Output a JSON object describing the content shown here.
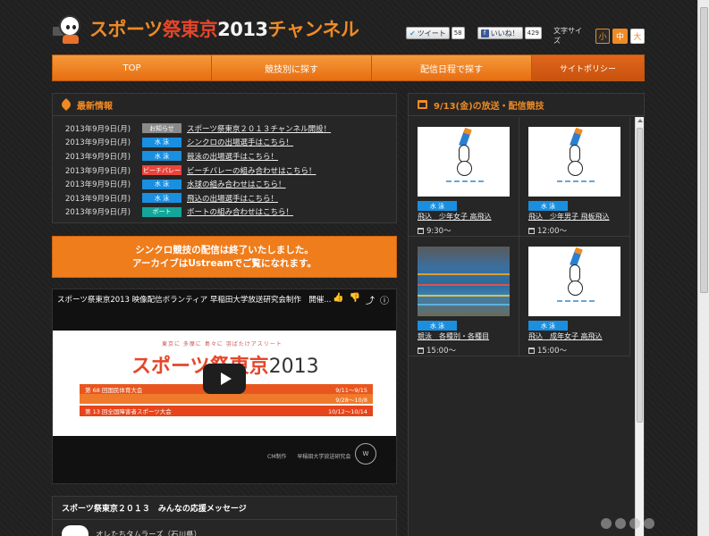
{
  "header": {
    "logo_parts": [
      "スポーツ",
      "祭",
      "東京",
      "2013",
      "チャンネル"
    ],
    "tweet_label": "ツイート",
    "tweet_count": "58",
    "like_label": "いいね！",
    "like_count": "429",
    "fontsize_label": "文字サイズ",
    "fontsize_small": "小",
    "fontsize_mid": "中",
    "fontsize_big": "大"
  },
  "nav": {
    "items": [
      "TOP",
      "競技別に探す",
      "配信日程で探す",
      "サイトポリシー"
    ]
  },
  "news": {
    "title": "最新情報",
    "rows": [
      {
        "date": "2013年9月9日(月)",
        "badge": "お知らせ",
        "badge_color": "#8a8a8a",
        "text": "スポーツ祭東京２０１３チャンネル開設！"
      },
      {
        "date": "2013年9月9日(月)",
        "badge": "水 泳",
        "badge_color": "#1a8fe0",
        "text": "シンクロの出場選手はこちら！"
      },
      {
        "date": "2013年9月9日(月)",
        "badge": "水 泳",
        "badge_color": "#1a8fe0",
        "text": "競泳の出場選手はこちら！"
      },
      {
        "date": "2013年9月9日(月)",
        "badge": "ビーチバレー",
        "badge_color": "#e8453c",
        "text": "ビーチバレーの組み合わせはこちら！"
      },
      {
        "date": "2013年9月9日(月)",
        "badge": "水 泳",
        "badge_color": "#1a8fe0",
        "text": "水球の組み合わせはこちら！"
      },
      {
        "date": "2013年9月9日(月)",
        "badge": "水 泳",
        "badge_color": "#1a8fe0",
        "text": "飛込の出場選手はこちら！"
      },
      {
        "date": "2013年9月9日(月)",
        "badge": "ボート",
        "badge_color": "#14a69a",
        "text": "ボートの組み合わせはこちら！"
      }
    ]
  },
  "notice": {
    "line1": "シンクロ競技の配信は終了いたしました。",
    "line2": "アーカイブはUstreamでご覧になれます。"
  },
  "video": {
    "title": "スポーツ祭東京2013 映像配信ボランティア 早稲田大学放送研究会制作　開催...",
    "slogan": "東京に 多摩に 島々に 羽ばたけアスリート",
    "logo_a": "スポーツ",
    "logo_b": "祭東京",
    "logo_c": "2013",
    "band1_left": "第 68 回国民体育大会",
    "band1_right1": "9/11～9/15",
    "band1_right2": "9/28～10/8",
    "band2_left": "第 13 回全国障害者スポーツ大会",
    "band2_right": "10/12～10/14",
    "credit": "CM制作　　早稲田大学放送研究会"
  },
  "cheer": {
    "title": "スポーツ祭東京２０１３　みんなの応援メッセージ",
    "name": "オレたちタムラーズ（石川県）"
  },
  "schedule": {
    "title": "9/13(金)の放送・配信競技",
    "cards": [
      {
        "badge": "水 泳",
        "title": "飛込　少年女子 高飛込",
        "time": "9:30～",
        "thumb": "diver"
      },
      {
        "badge": "水 泳",
        "title": "飛込　少年男子 飛板飛込",
        "time": "12:00～",
        "thumb": "diver"
      },
      {
        "badge": "水 泳",
        "title": "競泳　各種別・各種目",
        "time": "15:00～",
        "thumb": "pool"
      },
      {
        "badge": "水 泳",
        "title": "飛込　成年女子 高飛込",
        "time": "15:00～",
        "thumb": "diver"
      }
    ]
  },
  "colors": {
    "accent": "#f08a24",
    "nav_gradient_top": "#f69a3a",
    "swim_badge": "#1a8fe0"
  }
}
